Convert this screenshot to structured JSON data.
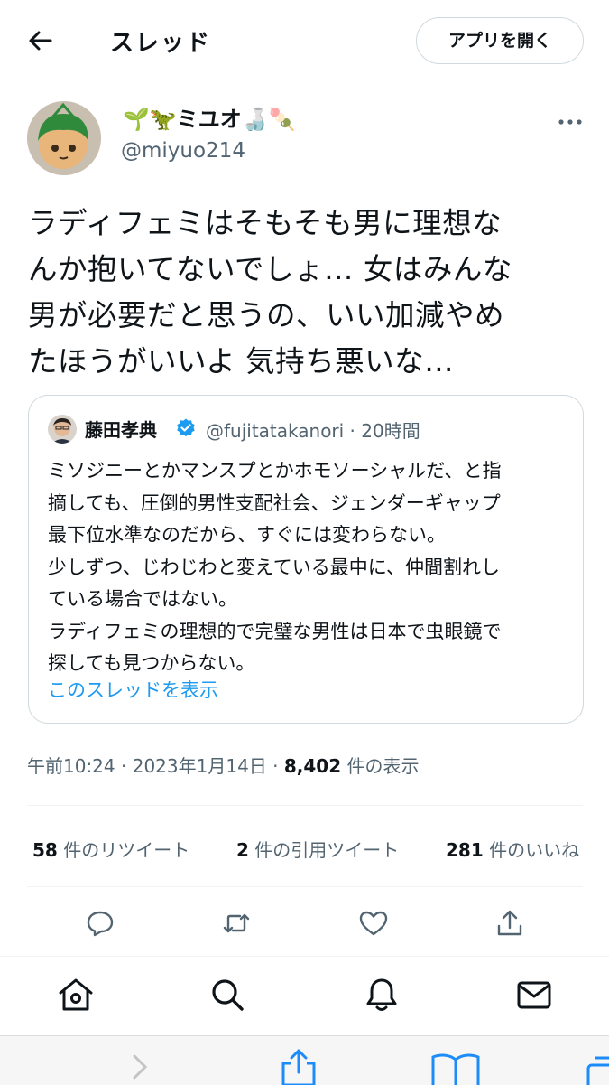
{
  "header": {
    "title": "スレッド",
    "open_app_label": "アプリを開く"
  },
  "tweet": {
    "display_name": "ミユオ",
    "handle": "@miyuo214",
    "text": "ラディフェミはそもそも男に理想なんか抱いてないでしょ… 女はみんな男が必要だと思うの、いい加減やめたほうがいいよ 気持ち悪いな…",
    "lines": [
      "ラディフェミはそもそも男に理想な",
      "んか抱いてないでしょ… 女はみんな",
      "男が必要だと思うの、いい加減やめ",
      "たほうがいいよ 気持ち悪いな…"
    ],
    "time": "午前10:24",
    "date": "2023年1月14日",
    "views_count": "8,402",
    "views_label": "件の表示",
    "retweets_count": "58",
    "retweets_label": "件のリツイート",
    "quotes_count": "2",
    "quotes_label": "件の引用ツイート",
    "likes_count": "281",
    "likes_label": "件のいいね"
  },
  "quote": {
    "name": "藤田孝典",
    "handle": "@fujitatakanori",
    "time": "20時間",
    "text": "ミソジニーとかマンスプとかホモソーシャルだ、と指\n摘しても、圧倒的男性支配社会、ジェンダーギャップ\n最下位水準なのだから、すぐには変わらない。\n少しずつ、じわじわと変えている最中に、仲間割れし\nている場合ではない。\nラディフェミの理想的で完璧な男性は日本で虫眼鏡で\n探しても見つからない。",
    "show_thread_label": "このスレッドを表示"
  },
  "colors": {
    "text": "#0f1419",
    "secondary": "#536471",
    "accent": "#1d9bf0",
    "border": "#cfd9de"
  },
  "icons": [
    "back-arrow-icon",
    "more-icon",
    "verified-badge-icon",
    "reply-icon",
    "retweet-icon",
    "like-icon",
    "share-icon",
    "home-icon",
    "search-icon",
    "notifications-icon",
    "messages-icon"
  ]
}
